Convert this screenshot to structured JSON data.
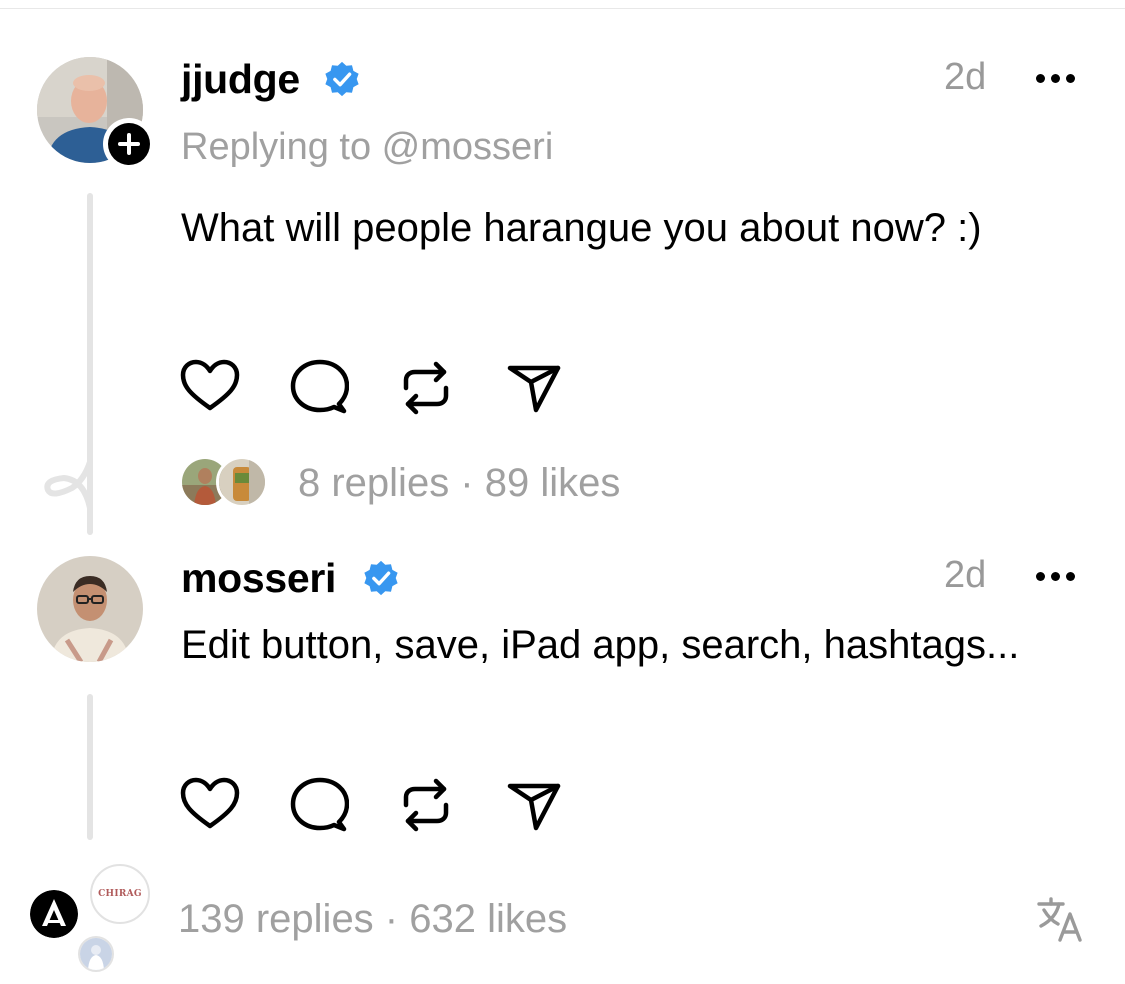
{
  "posts": [
    {
      "username": "jjudge",
      "verified": true,
      "time": "2d",
      "replying_to": "Replying to @mosseri",
      "text": "What will people harangue you about now? :)",
      "stats": "8 replies · 89 likes"
    },
    {
      "username": "mosseri",
      "verified": true,
      "time": "2d",
      "text": "Edit button, save, iPad app, search, hashtags...",
      "stats": "139 replies · 632 likes"
    }
  ],
  "reply_avatar_labels": {
    "chirag": "CHIRAG"
  },
  "icons": {
    "like": "heart-icon",
    "reply": "comment-icon",
    "repost": "repost-icon",
    "share": "send-icon",
    "translate": "translate-icon",
    "more": "more-icon",
    "follow": "plus-icon",
    "verified": "verified-badge-icon"
  },
  "colors": {
    "verified": "#3897f0",
    "muted_text": "#a0a0a0",
    "thread_line": "#e4e4e4"
  }
}
